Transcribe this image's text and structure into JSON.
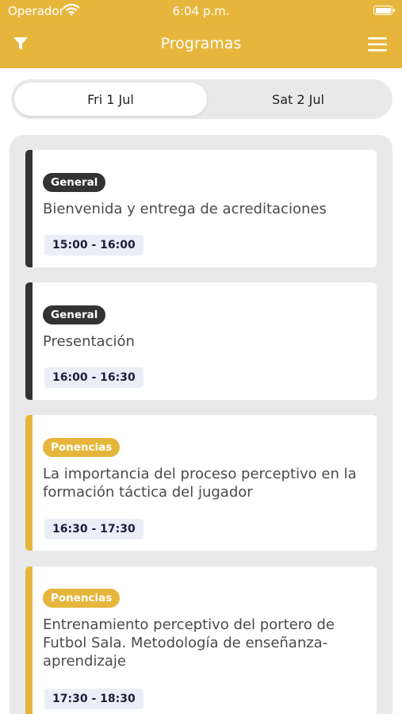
{
  "status_bar": {
    "carrier": "Operador",
    "time": "6:04 p.m."
  },
  "header": {
    "title": "Programas",
    "filter_icon": "filter-icon",
    "menu_icon": "hamburger-menu-icon"
  },
  "colors": {
    "header_bg": "#e6b63c",
    "general": "#333333",
    "ponencias": "#e6b63c"
  },
  "tabs": [
    {
      "label": "Fri 1 Jul",
      "selected": true
    },
    {
      "label": "Sat 2 Jul",
      "selected": false
    }
  ],
  "sessions": [
    {
      "category": "General",
      "title": "Bienvenida y entrega de acreditaciones",
      "time": "15:00 - 16:00"
    },
    {
      "category": "General",
      "title": "Presentación",
      "time": "16:00 - 16:30"
    },
    {
      "category": "Ponencias",
      "title": "La importancia del proceso perceptivo en la formación táctica del jugador",
      "time": "16:30 - 17:30"
    },
    {
      "category": "Ponencias",
      "title": "Entrenamiento perceptivo del portero de Futbol Sala. Metodología de enseñanza-aprendizaje",
      "time": "17:30 - 18:30"
    }
  ]
}
